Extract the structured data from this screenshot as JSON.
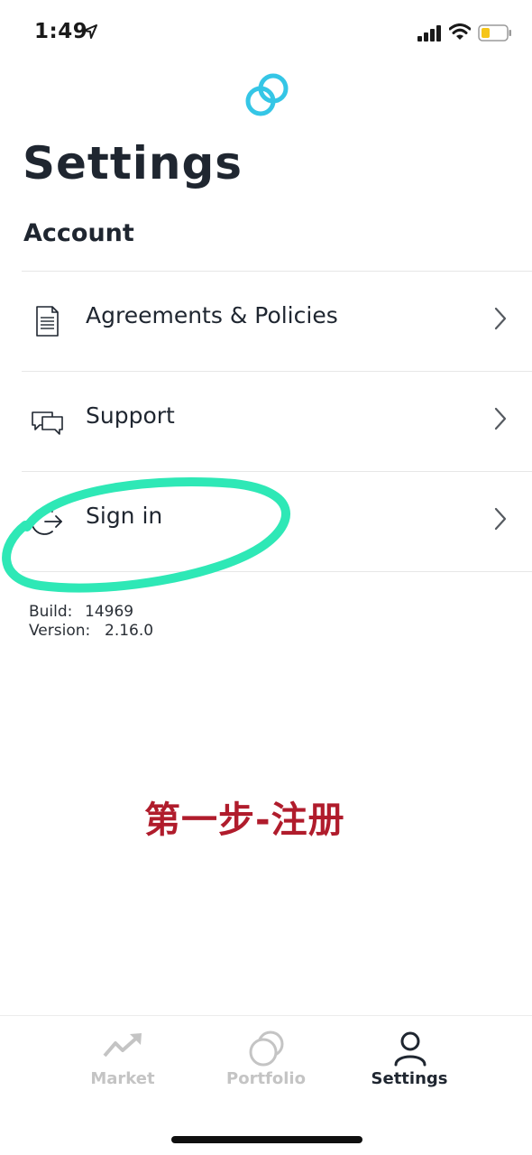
{
  "status_bar": {
    "time": "1:49",
    "location_icon": "location-arrow-icon",
    "signal_icon": "cellular-signal-icon",
    "wifi_icon": "wifi-icon",
    "battery_icon": "battery-low-icon",
    "battery_color": "#f5c518"
  },
  "header": {
    "logo_icon": "gemini-logo-icon",
    "logo_color": "#35c6e6",
    "title": "Settings"
  },
  "account": {
    "heading": "Account",
    "items": [
      {
        "label": "Agreements & Policies",
        "icon": "document-icon"
      },
      {
        "label": "Support",
        "icon": "chat-bubbles-icon"
      },
      {
        "label": "Sign in",
        "icon": "sign-in-icon"
      }
    ]
  },
  "build_info": {
    "build_label": "Build:",
    "build_value": "14969",
    "version_label": "Version:",
    "version_value": "2.16.0"
  },
  "annotation": {
    "text": "第一步-注册",
    "highlight_color": "#2ee8b6",
    "text_color": "#b01c2c"
  },
  "tab_bar": {
    "tabs": [
      {
        "label": "Market",
        "icon": "trending-up-icon",
        "active": false
      },
      {
        "label": "Portfolio",
        "icon": "portfolio-circles-icon",
        "active": false
      },
      {
        "label": "Settings",
        "icon": "person-icon",
        "active": true
      }
    ]
  }
}
